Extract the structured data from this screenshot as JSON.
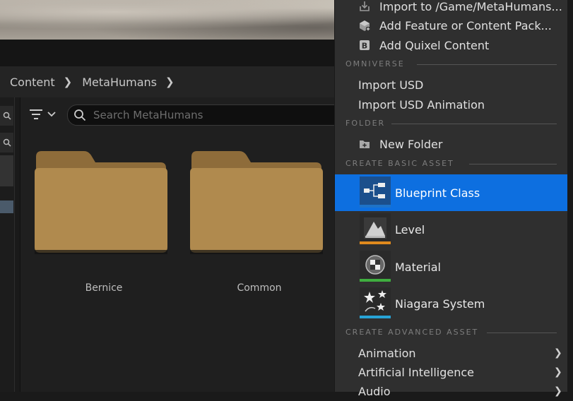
{
  "breadcrumb": {
    "items": [
      "Content",
      "MetaHumans"
    ],
    "separator": ">"
  },
  "search": {
    "placeholder": "Search MetaHumans"
  },
  "folders": [
    {
      "name": "Bernice"
    },
    {
      "name": "Common"
    }
  ],
  "menu": {
    "top_items": [
      {
        "label": "Import to /Game/MetaHumans...",
        "icon": "import-icon"
      },
      {
        "label": "Add Feature or Content Pack...",
        "icon": "content-pack-icon"
      },
      {
        "label": "Add Quixel Content",
        "icon": "quixel-icon"
      }
    ],
    "sections": {
      "omniverse": "OMNIVERSE",
      "folder": "FOLDER",
      "create_basic": "CREATE BASIC ASSET",
      "create_advanced": "CREATE ADVANCED ASSET"
    },
    "omniverse_items": [
      "Import USD",
      "Import USD Animation"
    ],
    "folder_items": [
      {
        "label": "New Folder",
        "icon": "new-folder-icon"
      }
    ],
    "basic_assets": [
      {
        "label": "Blueprint Class",
        "icon": "blueprint-icon",
        "color": "#1e73c8",
        "selected": true
      },
      {
        "label": "Level",
        "icon": "level-icon",
        "color": "#e08a1e",
        "selected": false
      },
      {
        "label": "Material",
        "icon": "material-icon",
        "color": "#3fae3f",
        "selected": false
      },
      {
        "label": "Niagara System",
        "icon": "niagara-icon",
        "color": "#27a3d6",
        "selected": false
      }
    ],
    "advanced_items": [
      "Animation",
      "Artificial Intelligence",
      "Audio"
    ]
  },
  "colors": {
    "selection": "#0d6fe0",
    "folder": "#b08a4e"
  }
}
